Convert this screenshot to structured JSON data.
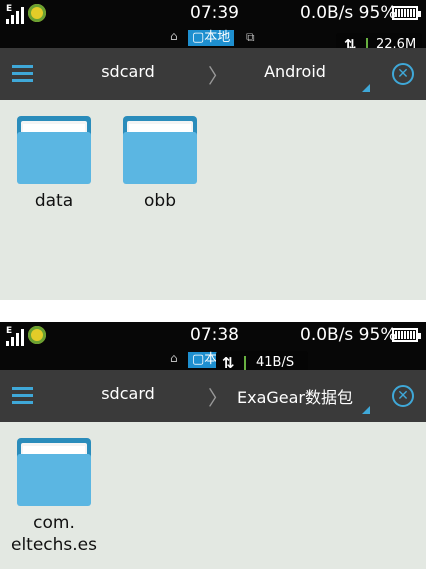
{
  "screens": [
    {
      "status": {
        "time": "07:39",
        "speed_battery": "0.0B/s 95%"
      },
      "location_chip": "本地",
      "speed_popup": "22.6M",
      "path": {
        "root": "sdcard",
        "current": "Android"
      },
      "folders": [
        {
          "name": "data"
        },
        {
          "name": "obb"
        }
      ]
    },
    {
      "status": {
        "time": "07:38",
        "speed_battery": "0.0B/s 95%"
      },
      "location_chip": "本地",
      "speed_popup": "41B/S",
      "path": {
        "root": "sdcard",
        "current": "ExaGear数据包"
      },
      "folders": [
        {
          "name_line1": "com.",
          "name_line2": "eltechs.es"
        }
      ]
    }
  ],
  "colors": {
    "accent": "#3fa8d8",
    "toolbar": "#3a3a3a",
    "background": "#e3e8e2",
    "folder": "#5bb6e2"
  },
  "icons": [
    "signal-icon",
    "app-badge-icon",
    "battery-icon",
    "home-icon",
    "network-icon",
    "transfer-icon",
    "menu-icon",
    "close-icon",
    "folder-icon"
  ]
}
